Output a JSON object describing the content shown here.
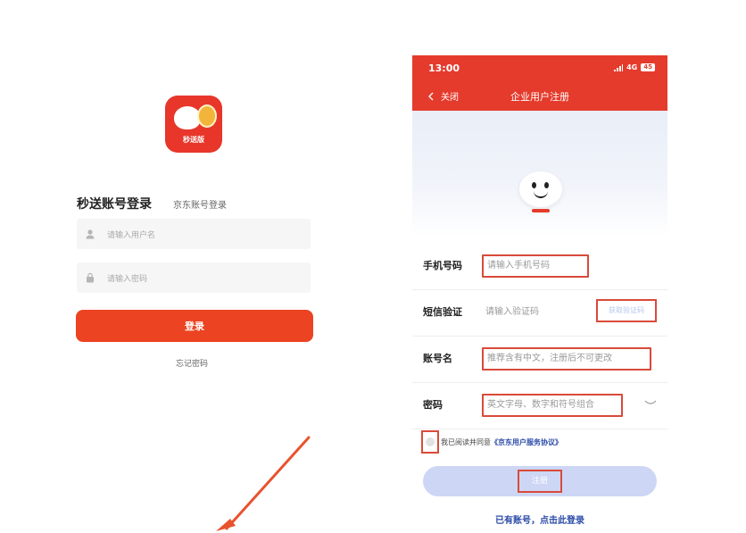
{
  "left": {
    "app_badge": "秒送版",
    "tab_active": "秒送账号登录",
    "tab_inactive": "京东账号登录",
    "username_placeholder": "请输入用户名",
    "password_placeholder": "请输入密码",
    "login_button": "登录",
    "forgot_password": "忘记密码",
    "icons": {
      "user": "user-icon",
      "lock": "lock-icon"
    },
    "accent_color": "#ec4322"
  },
  "right": {
    "status": {
      "time": "13:00",
      "network": "4G",
      "battery": "45"
    },
    "header": {
      "back_label": "关闭",
      "title": "企业用户注册"
    },
    "form": {
      "phone": {
        "label": "手机号码",
        "placeholder": "请输入手机号码"
      },
      "sms": {
        "label": "短信验证",
        "placeholder": "请输入验证码",
        "get_code": "获取验证码"
      },
      "account": {
        "label": "账号名",
        "placeholder": "推荐含有中文，注册后不可更改"
      },
      "password": {
        "label": "密码",
        "placeholder": "英文字母、数字和符号组合"
      }
    },
    "agreement": {
      "prefix": "我已阅读并同意",
      "link": "《京东用户服务协议》"
    },
    "register_button": "注册",
    "login_link": "已有账号，点击此登录",
    "header_color": "#e53b2c",
    "highlight_color": "#d94a3a"
  }
}
